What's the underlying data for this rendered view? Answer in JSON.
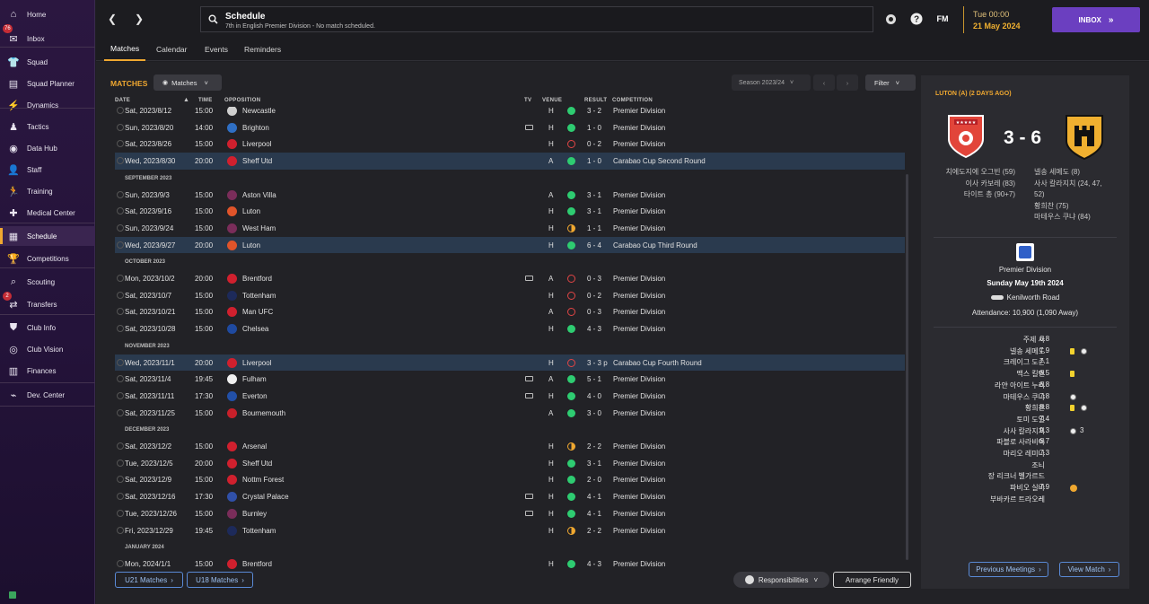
{
  "sidebar": {
    "items": [
      {
        "label": "Home",
        "icon": "home-icon"
      },
      {
        "label": "Inbox",
        "icon": "inbox-icon",
        "badge": "76"
      },
      {
        "label": "Squad",
        "icon": "shirt-icon"
      },
      {
        "label": "Squad Planner",
        "icon": "planner-icon"
      },
      {
        "label": "Dynamics",
        "icon": "dynamics-icon"
      },
      {
        "label": "Tactics",
        "icon": "tactics-icon"
      },
      {
        "label": "Data Hub",
        "icon": "data-hub-icon"
      },
      {
        "label": "Staff",
        "icon": "staff-icon"
      },
      {
        "label": "Training",
        "icon": "training-icon"
      },
      {
        "label": "Medical Center",
        "icon": "medical-icon"
      },
      {
        "label": "Schedule",
        "icon": "calendar-icon"
      },
      {
        "label": "Competitions",
        "icon": "trophy-icon"
      },
      {
        "label": "Scouting",
        "icon": "scouting-icon"
      },
      {
        "label": "Transfers",
        "icon": "transfers-icon",
        "badge": "2"
      },
      {
        "label": "Club Info",
        "icon": "shield-icon"
      },
      {
        "label": "Club Vision",
        "icon": "vision-icon"
      },
      {
        "label": "Finances",
        "icon": "finances-icon"
      },
      {
        "label": "Dev. Center",
        "icon": "dev-center-icon"
      }
    ]
  },
  "header": {
    "title": "Schedule",
    "subtitle": "7th in English Premier Division - No match scheduled.",
    "fm": "FM",
    "time": "Tue 00:00",
    "date": "21 May 2024",
    "inbox": "INBOX"
  },
  "tabs": [
    "Matches",
    "Calendar",
    "Events",
    "Reminders"
  ],
  "matches": {
    "heading": "MATCHES",
    "view_dropdown": "Matches",
    "season_dropdown": "Season 2023/24",
    "filter": "Filter",
    "columns": {
      "date": "DATE",
      "time": "TIME",
      "opposition": "OPPOSITION",
      "tv": "TV",
      "venue": "VENUE",
      "result": "RESULT",
      "competition": "COMPETITION"
    },
    "rows": [
      {
        "type": "match",
        "date": "Sat, 2023/8/12",
        "time": "15:00",
        "opp": "Newcastle",
        "tv": false,
        "venue": "H",
        "res": "W",
        "score": "3 - 2",
        "comp": "Premier Division",
        "crest": "#cfcfcf",
        "cut": true
      },
      {
        "type": "match",
        "date": "Sun, 2023/8/20",
        "time": "14:00",
        "opp": "Brighton",
        "tv": true,
        "venue": "H",
        "res": "W",
        "score": "1 - 0",
        "comp": "Premier Division",
        "crest": "#2f6fc4"
      },
      {
        "type": "match",
        "date": "Sat, 2023/8/26",
        "time": "15:00",
        "opp": "Liverpool",
        "tv": false,
        "venue": "H",
        "res": "L",
        "score": "0 - 2",
        "comp": "Premier Division",
        "crest": "#d0202e"
      },
      {
        "type": "match",
        "date": "Wed, 2023/8/30",
        "time": "20:00",
        "opp": "Sheff Utd",
        "tv": false,
        "venue": "A",
        "res": "W",
        "score": "1 - 0",
        "comp": "Carabao Cup Second Round",
        "crest": "#d0202e",
        "hl": true
      },
      {
        "type": "month",
        "label": "SEPTEMBER 2023"
      },
      {
        "type": "match",
        "date": "Sun, 2023/9/3",
        "time": "15:00",
        "opp": "Aston Villa",
        "tv": false,
        "venue": "A",
        "res": "W",
        "score": "3 - 1",
        "comp": "Premier Division",
        "crest": "#7a2d5a"
      },
      {
        "type": "match",
        "date": "Sat, 2023/9/16",
        "time": "15:00",
        "opp": "Luton",
        "tv": false,
        "venue": "H",
        "res": "W",
        "score": "3 - 1",
        "comp": "Premier Division",
        "crest": "#e0542a"
      },
      {
        "type": "match",
        "date": "Sun, 2023/9/24",
        "time": "15:00",
        "opp": "West Ham",
        "tv": false,
        "venue": "H",
        "res": "D",
        "score": "1 - 1",
        "comp": "Premier Division",
        "crest": "#7a2d5a"
      },
      {
        "type": "match",
        "date": "Wed, 2023/9/27",
        "time": "20:00",
        "opp": "Luton",
        "tv": false,
        "venue": "H",
        "res": "W",
        "score": "6 - 4",
        "comp": "Carabao Cup Third Round",
        "crest": "#e0542a",
        "hl": true
      },
      {
        "type": "month",
        "label": "OCTOBER 2023"
      },
      {
        "type": "match",
        "date": "Mon, 2023/10/2",
        "time": "20:00",
        "opp": "Brentford",
        "tv": true,
        "venue": "A",
        "res": "L",
        "score": "0 - 3",
        "comp": "Premier Division",
        "crest": "#d0202e"
      },
      {
        "type": "match",
        "date": "Sat, 2023/10/7",
        "time": "15:00",
        "opp": "Tottenham",
        "tv": false,
        "venue": "H",
        "res": "L",
        "score": "0 - 2",
        "comp": "Premier Division",
        "crest": "#1d2a5a"
      },
      {
        "type": "match",
        "date": "Sat, 2023/10/21",
        "time": "15:00",
        "opp": "Man UFC",
        "tv": false,
        "venue": "A",
        "res": "L",
        "score": "0 - 3",
        "comp": "Premier Division",
        "crest": "#d0202e"
      },
      {
        "type": "match",
        "date": "Sat, 2023/10/28",
        "time": "15:00",
        "opp": "Chelsea",
        "tv": false,
        "venue": "H",
        "res": "W",
        "score": "4 - 3",
        "comp": "Premier Division",
        "crest": "#1f4aa0"
      },
      {
        "type": "month",
        "label": "NOVEMBER 2023"
      },
      {
        "type": "match",
        "date": "Wed, 2023/11/1",
        "time": "20:00",
        "opp": "Liverpool",
        "tv": false,
        "venue": "H",
        "res": "L",
        "score": "3 - 3 p",
        "comp": "Carabao Cup Fourth Round",
        "crest": "#d0202e",
        "hl": true
      },
      {
        "type": "match",
        "date": "Sat, 2023/11/4",
        "time": "19:45",
        "opp": "Fulham",
        "tv": true,
        "venue": "A",
        "res": "W",
        "score": "5 - 1",
        "comp": "Premier Division",
        "crest": "#f0f0f0"
      },
      {
        "type": "match",
        "date": "Sat, 2023/11/11",
        "time": "17:30",
        "opp": "Everton",
        "tv": true,
        "venue": "H",
        "res": "W",
        "score": "4 - 0",
        "comp": "Premier Division",
        "crest": "#2250a8"
      },
      {
        "type": "match",
        "date": "Sat, 2023/11/25",
        "time": "15:00",
        "opp": "Bournemouth",
        "tv": false,
        "venue": "A",
        "res": "W",
        "score": "3 - 0",
        "comp": "Premier Division",
        "crest": "#c8202a"
      },
      {
        "type": "month",
        "label": "DECEMBER 2023"
      },
      {
        "type": "match",
        "date": "Sat, 2023/12/2",
        "time": "15:00",
        "opp": "Arsenal",
        "tv": false,
        "venue": "H",
        "res": "D",
        "score": "2 - 2",
        "comp": "Premier Division",
        "crest": "#d0202e"
      },
      {
        "type": "match",
        "date": "Tue, 2023/12/5",
        "time": "20:00",
        "opp": "Sheff Utd",
        "tv": false,
        "venue": "H",
        "res": "W",
        "score": "3 - 1",
        "comp": "Premier Division",
        "crest": "#d0202e"
      },
      {
        "type": "match",
        "date": "Sat, 2023/12/9",
        "time": "15:00",
        "opp": "Nottm Forest",
        "tv": false,
        "venue": "H",
        "res": "W",
        "score": "2 - 0",
        "comp": "Premier Division",
        "crest": "#d0202e"
      },
      {
        "type": "match",
        "date": "Sat, 2023/12/16",
        "time": "17:30",
        "opp": "Crystal Palace",
        "tv": true,
        "venue": "H",
        "res": "W",
        "score": "4 - 1",
        "comp": "Premier Division",
        "crest": "#3050a8"
      },
      {
        "type": "match",
        "date": "Tue, 2023/12/26",
        "time": "15:00",
        "opp": "Burnley",
        "tv": true,
        "venue": "H",
        "res": "W",
        "score": "4 - 1",
        "comp": "Premier Division",
        "crest": "#7a2d5a"
      },
      {
        "type": "match",
        "date": "Fri, 2023/12/29",
        "time": "19:45",
        "opp": "Tottenham",
        "tv": false,
        "venue": "H",
        "res": "D",
        "score": "2 - 2",
        "comp": "Premier Division",
        "crest": "#1d2a5a"
      },
      {
        "type": "month",
        "label": "JANUARY 2024"
      },
      {
        "type": "match",
        "date": "Mon, 2024/1/1",
        "time": "15:00",
        "opp": "Brentford",
        "tv": false,
        "venue": "H",
        "res": "W",
        "score": "4 - 3",
        "comp": "Premier Division",
        "crest": "#d0202e"
      }
    ]
  },
  "bottom": {
    "u21": "U21 Matches",
    "u18": "U18 Matches",
    "responsibilities": "Responsibilities",
    "arrange_friendly": "Arrange Friendly"
  },
  "panel": {
    "heading": "LUTON (A) (2 DAYS AGO)",
    "score": "3 - 6",
    "home_scorers": [
      "치에도지에 오그빈 (59)",
      "이사 카보레 (83)",
      "타이트 총 (90+7)"
    ],
    "away_scorers": [
      "넬송 세메도 (8)",
      "사사 칼라지치 (24, 47,",
      "52)",
      "황희찬 (75)",
      "마테우스 쿠냐 (84)"
    ],
    "competition": "Premier Division",
    "match_date": "Sunday May 19th 2024",
    "stadium": "Kenilworth Road",
    "attendance": "Attendance: 10,900 (1,090 Away)",
    "ratings": [
      {
        "name": "주제 사",
        "rating": "6.8",
        "marks": []
      },
      {
        "name": "넬송 세메도",
        "rating": "7.9",
        "marks": [
          "yellow",
          "goal"
        ]
      },
      {
        "name": "크레이그 도슨",
        "rating": "7.1",
        "marks": []
      },
      {
        "name": "맥스 킬먼",
        "rating": "6.5",
        "marks": [
          "yellow"
        ]
      },
      {
        "name": "라얀 아이트 누리",
        "rating": "6.8",
        "marks": []
      },
      {
        "name": "마테우스 쿠냐",
        "rating": "7.8",
        "marks": [
          "goal"
        ]
      },
      {
        "name": "황희찬",
        "rating": "8.8",
        "marks": [
          "yellow",
          "goal"
        ]
      },
      {
        "name": "토미 도일",
        "rating": "7.4",
        "marks": []
      },
      {
        "name": "사사 칼라지치",
        "rating": "9.3",
        "marks": [
          "goal"
        ],
        "extra": "3"
      },
      {
        "name": "파블로 사라비아",
        "rating": "6.7",
        "marks": []
      },
      {
        "name": "마리오 레미나",
        "rating": "7.3",
        "marks": []
      },
      {
        "name": "조니",
        "rating": "-",
        "marks": []
      },
      {
        "name": "장 리크너 벨가르드",
        "rating": "-",
        "marks": []
      },
      {
        "name": "파비오 실바",
        "rating": "7.9",
        "marks": [
          "pom"
        ]
      },
      {
        "name": "부바카르 트라오레",
        "rating": "-",
        "marks": []
      }
    ],
    "prev_meetings": "Previous Meetings",
    "view_match": "View Match"
  },
  "colors": {
    "accent": "#f0a830",
    "win": "#2ecc71",
    "loss": "#e04545",
    "draw": "#f0a830",
    "inbox": "#6b3fc0",
    "link": "#5a8ad6"
  }
}
